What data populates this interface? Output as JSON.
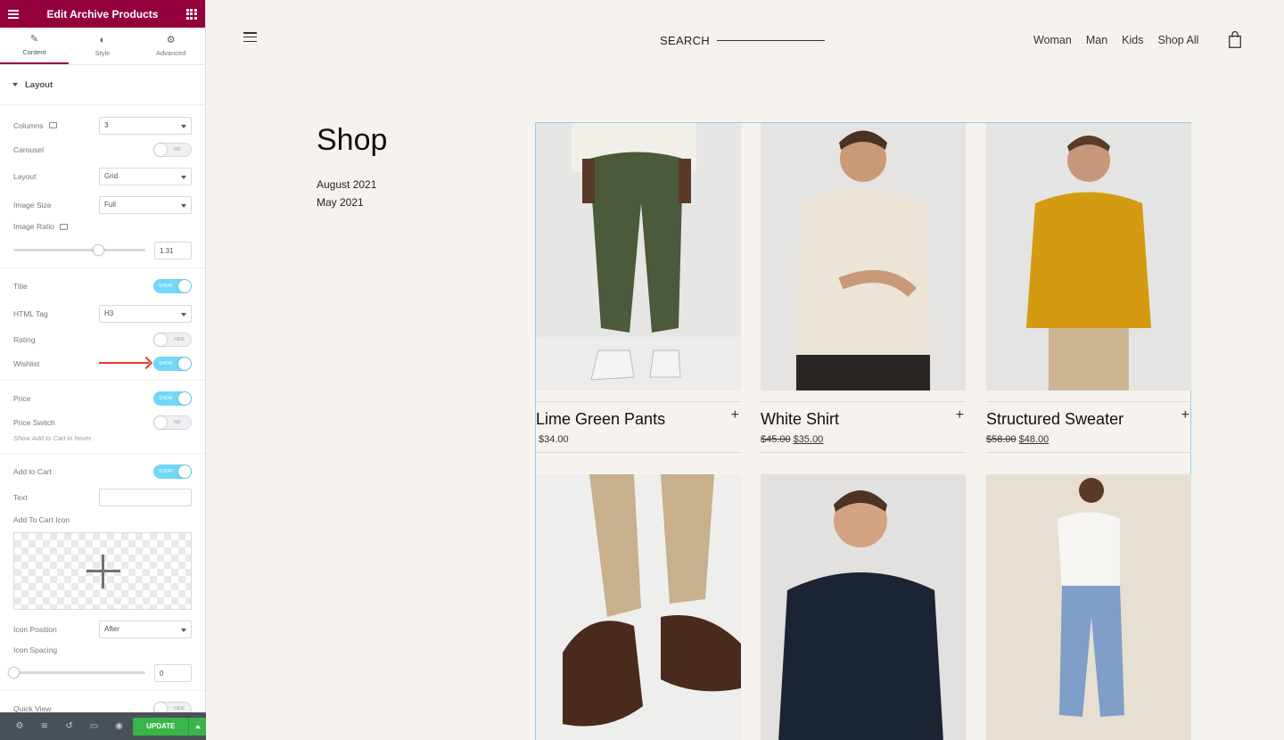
{
  "panel": {
    "title": "Edit Archive Products",
    "tabs": [
      {
        "label": "Content",
        "icon": "pencil-icon"
      },
      {
        "label": "Style",
        "icon": "half-circle-icon"
      },
      {
        "label": "Advanced",
        "icon": "gear-icon"
      }
    ],
    "section_title": "Layout",
    "columns": {
      "label": "Columns",
      "value": "3"
    },
    "carousel": {
      "label": "Carousel",
      "toggle": "NO"
    },
    "layout": {
      "label": "Layout",
      "value": "Grid"
    },
    "image_size": {
      "label": "Image Size",
      "value": "Full"
    },
    "image_ratio": {
      "label": "Image Ratio",
      "value": "1.31",
      "slider_fraction": 0.64
    },
    "title_ctrl": {
      "label": "Title",
      "toggle": "SHOW"
    },
    "html_tag": {
      "label": "HTML Tag",
      "value": "H3"
    },
    "rating": {
      "label": "Rating",
      "toggle": "HIDE"
    },
    "wishlist": {
      "label": "Wishlist",
      "toggle": "SHOW"
    },
    "price": {
      "label": "Price",
      "toggle": "SHOW"
    },
    "price_switch": {
      "label": "Price Switch",
      "toggle": "NO"
    },
    "price_note": "Show Add to Cart in hover.",
    "add_to_cart": {
      "label": "Add to Cart",
      "toggle": "SHOW"
    },
    "text": {
      "label": "Text",
      "value": ""
    },
    "cart_icon": {
      "label": "Add To Cart Icon"
    },
    "icon_position": {
      "label": "Icon Position",
      "value": "After"
    },
    "icon_spacing": {
      "label": "Icon Spacing",
      "value": "0",
      "slider_fraction": 0
    },
    "quick_view": {
      "label": "Quick View",
      "toggle": "HIDE"
    },
    "footer": {
      "update_label": "UPDATE"
    },
    "accent": "#93003c",
    "toggle_on_color": "#71d7f7",
    "update_color": "#39b54a"
  },
  "site": {
    "search_label": "SEARCH",
    "nav": [
      "Woman",
      "Man",
      "Kids",
      "Shop All"
    ],
    "page_title": "Shop",
    "archives": [
      "August 2021",
      "May 2021"
    ],
    "products": [
      {
        "name": "Lime Green Pants",
        "price_old": "",
        "price": "$34.00"
      },
      {
        "name": "White Shirt",
        "price_old": "$45.00",
        "price": "$35.00"
      },
      {
        "name": "Structured Sweater",
        "price_old": "$58.00",
        "price": "$48.00"
      },
      {
        "name": "",
        "price_old": "",
        "price": ""
      },
      {
        "name": "",
        "price_old": "",
        "price": ""
      },
      {
        "name": "",
        "price_old": "",
        "price": ""
      }
    ],
    "add_symbol": "+"
  }
}
